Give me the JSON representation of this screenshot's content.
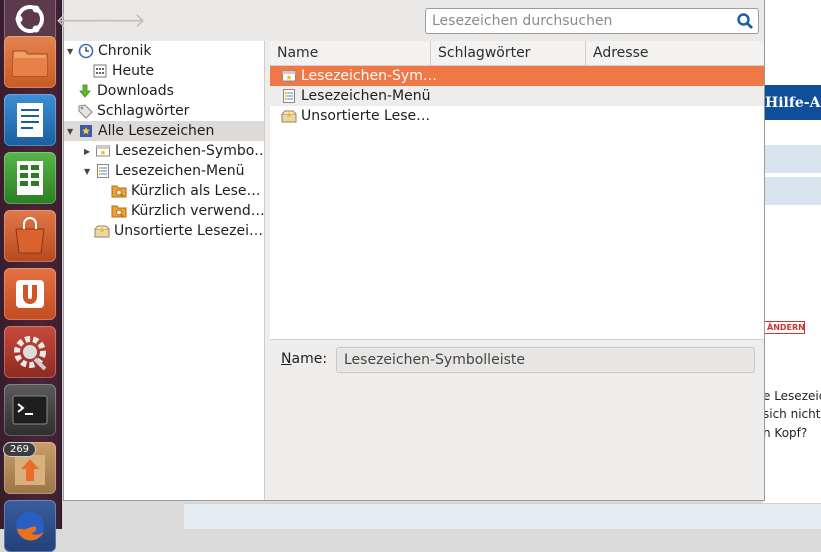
{
  "launcher": {
    "items": [
      {
        "name": "ubuntu-dash"
      },
      {
        "name": "files"
      },
      {
        "name": "writer"
      },
      {
        "name": "calc"
      },
      {
        "name": "software-center"
      },
      {
        "name": "ubuntu-one"
      },
      {
        "name": "system-settings"
      },
      {
        "name": "terminal"
      },
      {
        "name": "update-manager"
      },
      {
        "name": "firefox"
      }
    ],
    "update_badge": "269"
  },
  "toolbar": {
    "search_placeholder": "Lesezeichen durchsuchen"
  },
  "sidebar": {
    "items": [
      {
        "label": "Chronik"
      },
      {
        "label": "Heute"
      },
      {
        "label": "Downloads"
      },
      {
        "label": "Schlagwörter"
      },
      {
        "label": "Alle Lesezeichen"
      },
      {
        "label": "Lesezeichen-Symbo…"
      },
      {
        "label": "Lesezeichen-Menü"
      },
      {
        "label": "Kürzlich als Lese…"
      },
      {
        "label": "Kürzlich verwend…"
      },
      {
        "label": "Unsortierte Lesezei…"
      }
    ]
  },
  "list": {
    "columns": [
      "Name",
      "Schlagwörter",
      "Adresse"
    ],
    "rows": [
      {
        "name": "Lesezeichen-Sym…"
      },
      {
        "name": "Lesezeichen-Menü"
      },
      {
        "name": "Unsortierte Lese…"
      }
    ]
  },
  "details": {
    "name_label_first": "N",
    "name_label_rest": "ame:",
    "name_value": "Lesezeichen-Symbolleiste"
  },
  "background_page": {
    "header": "Hilfe-A",
    "button": "ÄNDERN",
    "lines": [
      "e Lesezeic",
      "sich nicht g",
      "n Kopf?"
    ]
  },
  "colors": {
    "selection": "#f07746",
    "launcher_bg": "#4a2538",
    "page_header": "#0f4f9a"
  }
}
